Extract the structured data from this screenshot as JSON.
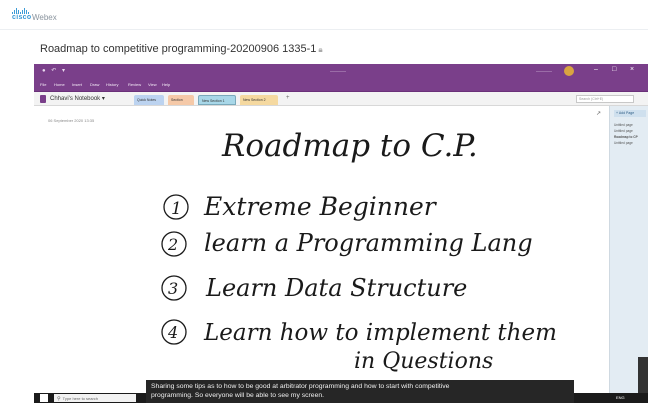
{
  "webex": {
    "logo_text": "cisco",
    "brand": "Webex"
  },
  "recording": {
    "title": "Roadmap to competitive programming-20200906 1335-1"
  },
  "onenote": {
    "notebook_name": "Chhavi's Notebook",
    "ribbon_tabs": [
      "File",
      "Home",
      "Insert",
      "Draw",
      "History",
      "Review",
      "View",
      "Help"
    ],
    "section_tabs": [
      {
        "label": "Quick Notes",
        "color": "#bcd3f0"
      },
      {
        "label": "Section",
        "color": "#f5c9a8"
      },
      {
        "label": "New Section 1",
        "color": "#a8d7e8"
      },
      {
        "label": "New Section 2",
        "color": "#f5d9a0"
      }
    ],
    "add_tab": "+",
    "search_placeholder": "Search (Ctrl+E)",
    "add_page": "+ Add Page",
    "pages": [
      "Untitled page",
      "Untitled page",
      "Roadmap to CP",
      "Untitled page"
    ],
    "page_date": "06 September 2020    13:35",
    "accent": "#7a3f8a"
  },
  "note": {
    "title": "Roadmap to C.P.",
    "items": [
      {
        "num": "1",
        "text": "Extreme Beginner"
      },
      {
        "num": "2",
        "text": "learn a Programming Lang"
      },
      {
        "num": "3",
        "text": "Learn Data Structure"
      },
      {
        "num": "4",
        "text": "Learn how to implement them",
        "text2": "in Questions"
      }
    ]
  },
  "caption": {
    "line1": "Sharing some tips as to how to be good at arbitrator programming and how to start with competitive",
    "line2": "programming. So everyone will be able to see my screen."
  },
  "taskbar": {
    "search": "Type here to search",
    "tray": "ENG"
  }
}
